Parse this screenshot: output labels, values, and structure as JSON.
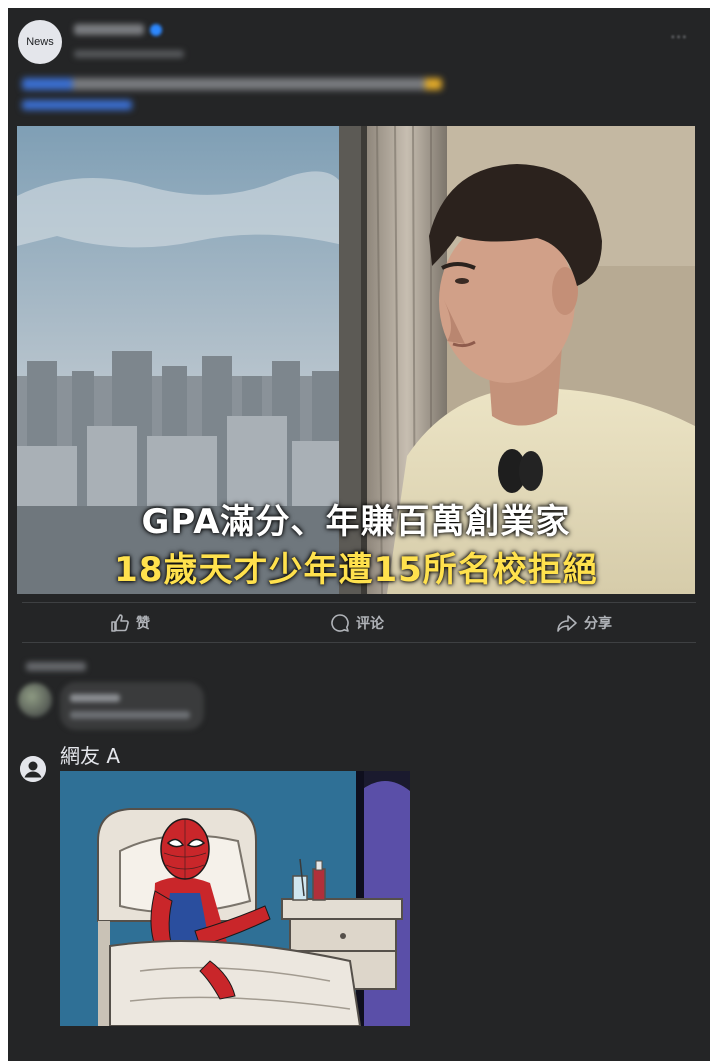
{
  "post": {
    "page_avatar_text": "News",
    "image_caption_line1": "GPA滿分、年賺百萬創業家",
    "image_caption_line2": "18歲天才少年遭15所名校拒絕"
  },
  "actions": {
    "like_label": "赞",
    "comment_label": "评论",
    "share_label": "分享"
  },
  "comments": [
    {
      "name": "網友 A",
      "image": "spider-man-in-hospital-bed-meme"
    }
  ],
  "colors": {
    "background": "#242526",
    "caption_white": "#ffffff",
    "caption_yellow": "#ffe14d",
    "action_text": "#b0b3b8"
  },
  "icons": [
    "like-icon",
    "comment-icon",
    "share-icon",
    "user-avatar-icon"
  ]
}
